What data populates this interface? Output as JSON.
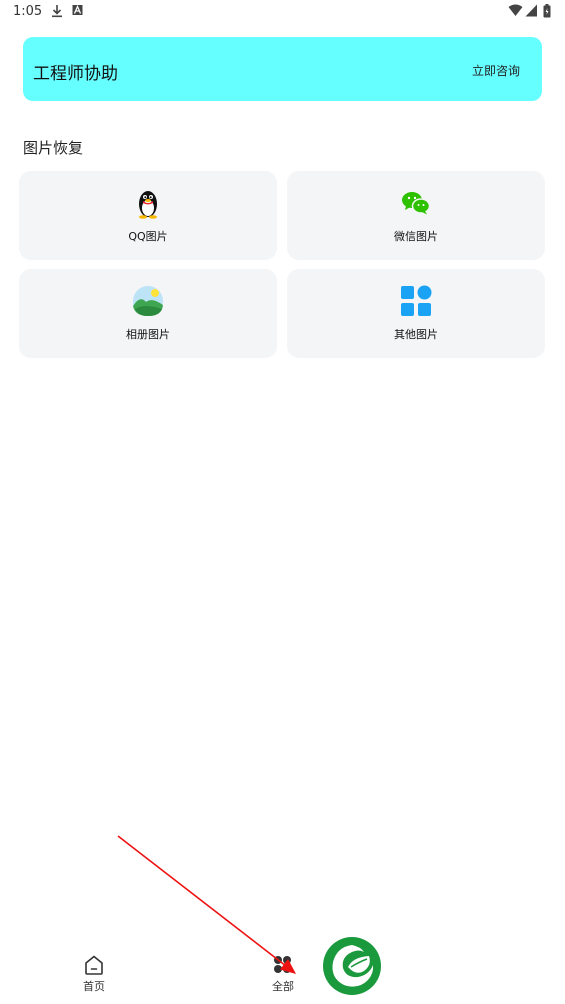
{
  "status_bar": {
    "time": "1:05"
  },
  "banner": {
    "title": "工程师协助",
    "action_label": "立即咨询"
  },
  "section": {
    "title": "图片恢复"
  },
  "cards": [
    {
      "label": "QQ图片",
      "icon": "qq-penguin-icon"
    },
    {
      "label": "微信图片",
      "icon": "wechat-icon"
    },
    {
      "label": "相册图片",
      "icon": "gallery-landscape-icon"
    },
    {
      "label": "其他图片",
      "icon": "apps-grid-icon"
    }
  ],
  "nav": {
    "items": [
      {
        "label": "首页",
        "icon": "home-icon"
      },
      {
        "label": "全部",
        "icon": "all-apps-icon"
      }
    ]
  },
  "colors": {
    "banner_bg": "#66ffff",
    "card_bg": "#f4f5f7",
    "wechat": "#2dc100",
    "blue_icon": "#1aa3f5",
    "logo_green": "#1a9a3c",
    "annotation_red": "#ee1111"
  }
}
